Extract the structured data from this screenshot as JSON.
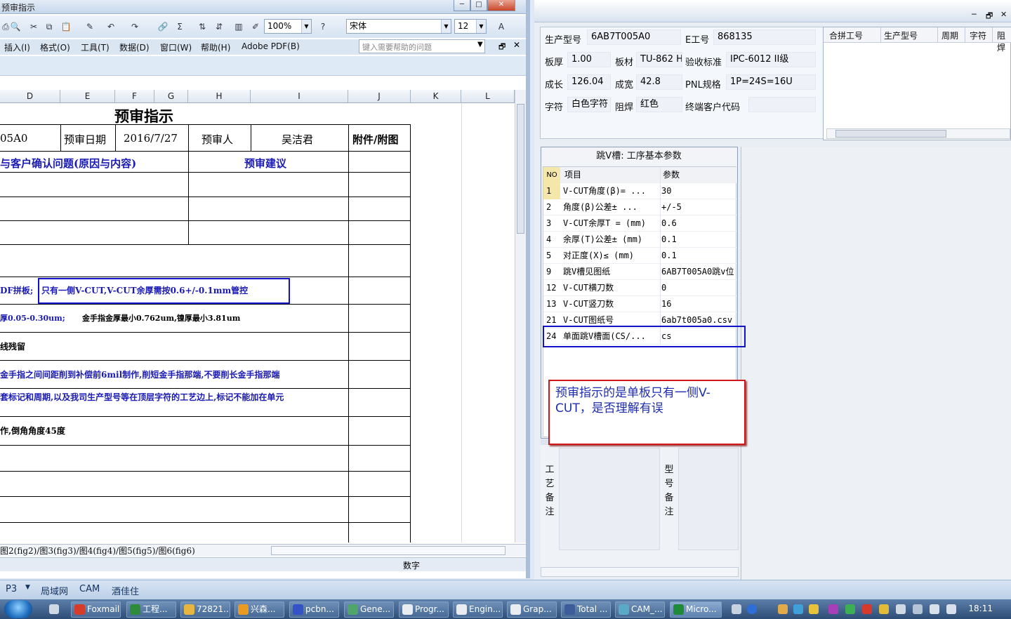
{
  "excel": {
    "window_title": "预审指示",
    "toolbar": {
      "zoom": "100%",
      "font": "宋体",
      "font_size": "12"
    },
    "menu": [
      "插入(I)",
      "格式(O)",
      "工具(T)",
      "数据(D)",
      "窗口(W)",
      "帮助(H)",
      "Adobe PDF(B)"
    ],
    "help_placeholder": "键入需要帮助的问题",
    "columns": [
      "D",
      "E",
      "F",
      "G",
      "H",
      "I",
      "J",
      "K",
      "L"
    ],
    "sheet": {
      "title": "预审指示",
      "r1": {
        "c1": "05A0",
        "c2": "预审日期",
        "c3": "2016/7/27",
        "c4": "预审人",
        "c5": "吴洁君",
        "c6": "附件/附图"
      },
      "r2": {
        "c1": "与客户确认问题(原因与内容)",
        "c2": "预审建议"
      },
      "lines": [
        "DF拼板;",
        "只有一侧V-CUT,V-CUT余厚需按0.6+/-0.1mm管控",
        "厚0.05-0.30um;",
        "金手指金厚最小0.762um,镍厚最小3.81um",
        "线残留",
        "金手指之间间距削到补偿前6mil制作,削短金手指那端,不要削长金手指那端",
        "套标记和周期,以及我司生产型号等在顶层字符的工艺边上,标记不能加在单元",
        "作,倒角角度45度"
      ]
    },
    "sheet_tabs": "图2(fig2)/图3(fig3)/图4(fig4)/图5(fig5)/图6(fig6)",
    "status": "数字"
  },
  "cam": {
    "info": {
      "prod_label": "生产型号",
      "prod": "6AB7T005A0",
      "e_label": "E工号",
      "e": "868135",
      "thick_label": "板厚",
      "thick": "1.00",
      "mat_label": "板材",
      "mat": "TU-862 H",
      "std_label": "验收标准",
      "std": "IPC-6012 II级",
      "len_label": "成长",
      "len": "126.04",
      "wid_label": "成宽",
      "wid": "42.8",
      "pnl_label": "PNL规格",
      "pnl": "1P=24S=16U",
      "char_label": "字符",
      "char": "白色字符",
      "mask_label": "阻焊",
      "mask": "红色",
      "end_label": "终端客户代码",
      "end": ""
    },
    "merge_headers": [
      "合拼工号",
      "生产型号",
      "周期",
      "字符",
      "阻焊"
    ],
    "vcut": {
      "title": "跳V槽: 工序基本参数",
      "headers": [
        "NO",
        "项目",
        "参数"
      ],
      "rows": [
        {
          "no": "1",
          "item": "V-CUT角度(β)=  ...",
          "val": "30"
        },
        {
          "no": "2",
          "item": "角度(β)公差±  ...",
          "val": "+/-5"
        },
        {
          "no": "3",
          "item": "V-CUT余厚T =  (mm)",
          "val": "0.6"
        },
        {
          "no": "4",
          "item": "余厚(T)公差±  (mm)",
          "val": "0.1"
        },
        {
          "no": "5",
          "item": "对正度(X)≤ (mm)",
          "val": "0.1"
        },
        {
          "no": "9",
          "item": "跳V槽见图纸",
          "val": "6AB7T005A0跳v位"
        },
        {
          "no": "12",
          "item": "V-CUT横刀数",
          "val": "0"
        },
        {
          "no": "13",
          "item": "V-CUT竖刀数",
          "val": "16"
        },
        {
          "no": "21",
          "item": "V-CUT图纸号",
          "val": "6ab7t005a0.csv"
        },
        {
          "no": "24",
          "item": "单面跳V槽面(CS/...",
          "val": "cs"
        }
      ]
    },
    "notes": {
      "left": "工艺备注",
      "right": "型号备注"
    }
  },
  "callout": "预审指示的是单板只有一侧V-CUT，是否理解有误",
  "toolbar2": [
    "P3",
    "局域网",
    "CAM",
    "酒佳住"
  ],
  "taskbar": {
    "items": [
      "Foxmail",
      "工程...",
      "72821...",
      "兴森...",
      "pcbn...",
      "Gene...",
      "Progr...",
      "Engin...",
      "Grap...",
      "Total ...",
      "CAM_...",
      "Micro..."
    ],
    "clock": "18:11"
  },
  "colors": {
    "highlight": "#1212c8",
    "callout_border": "#d01818",
    "blue_text": "#1a1ab4"
  }
}
